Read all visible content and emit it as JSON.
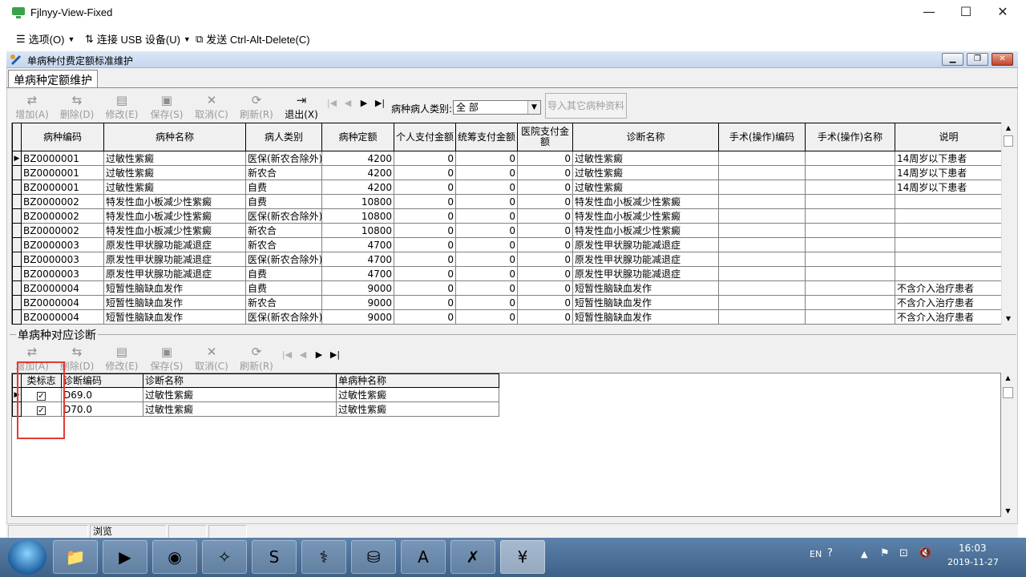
{
  "vm": {
    "title": "Fjlnyy-View-Fixed",
    "menu": {
      "options": "选项(O)",
      "usb": "连接 USB 设备(U)",
      "cad": "发送 Ctrl-Alt-Delete(C)"
    },
    "controls": {
      "min": "—",
      "max": "☐",
      "close": "✕"
    }
  },
  "app": {
    "title": "单病种付费定额标准维护",
    "tab": "单病种定额维护",
    "toolbar1": {
      "add": "增加(A)",
      "delete": "删除(D)",
      "edit": "修改(E)",
      "save": "保存(S)",
      "cancel": "取消(C)",
      "refresh": "刷新(R)",
      "exit": "退出(X)"
    },
    "filter_label": "病种病人类别:",
    "filter_value": "全 部",
    "import_button": "导入其它病种资料",
    "grid1": {
      "headers": [
        "病种编码",
        "病种名称",
        "病人类别",
        "病种定额",
        "个人支付金额",
        "统筹支付金额",
        "医院支付金额",
        "诊断名称",
        "手术(操作)编码",
        "手术(操作)名称",
        "说明"
      ],
      "rows": [
        [
          "BZ0000001",
          "过敏性紫癜",
          "医保(新农合除外)",
          "4200",
          "0",
          "0",
          "0",
          "过敏性紫癜",
          "",
          "",
          "14周岁以下患者"
        ],
        [
          "BZ0000001",
          "过敏性紫癜",
          "新农合",
          "4200",
          "0",
          "0",
          "0",
          "过敏性紫癜",
          "",
          "",
          "14周岁以下患者"
        ],
        [
          "BZ0000001",
          "过敏性紫癜",
          "自费",
          "4200",
          "0",
          "0",
          "0",
          "过敏性紫癜",
          "",
          "",
          "14周岁以下患者"
        ],
        [
          "BZ0000002",
          "特发性血小板减少性紫癜",
          "自费",
          "10800",
          "0",
          "0",
          "0",
          "特发性血小板减少性紫癜",
          "",
          "",
          ""
        ],
        [
          "BZ0000002",
          "特发性血小板减少性紫癜",
          "医保(新农合除外)",
          "10800",
          "0",
          "0",
          "0",
          "特发性血小板减少性紫癜",
          "",
          "",
          ""
        ],
        [
          "BZ0000002",
          "特发性血小板减少性紫癜",
          "新农合",
          "10800",
          "0",
          "0",
          "0",
          "特发性血小板减少性紫癜",
          "",
          "",
          ""
        ],
        [
          "BZ0000003",
          "原发性甲状腺功能减退症",
          "新农合",
          "4700",
          "0",
          "0",
          "0",
          "原发性甲状腺功能减退症",
          "",
          "",
          ""
        ],
        [
          "BZ0000003",
          "原发性甲状腺功能减退症",
          "医保(新农合除外)",
          "4700",
          "0",
          "0",
          "0",
          "原发性甲状腺功能减退症",
          "",
          "",
          ""
        ],
        [
          "BZ0000003",
          "原发性甲状腺功能减退症",
          "自费",
          "4700",
          "0",
          "0",
          "0",
          "原发性甲状腺功能减退症",
          "",
          "",
          ""
        ],
        [
          "BZ0000004",
          "短暂性脑缺血发作",
          "自费",
          "9000",
          "0",
          "0",
          "0",
          "短暂性脑缺血发作",
          "",
          "",
          "不含介入治疗患者"
        ],
        [
          "BZ0000004",
          "短暂性脑缺血发作",
          "新农合",
          "9000",
          "0",
          "0",
          "0",
          "短暂性脑缺血发作",
          "",
          "",
          "不含介入治疗患者"
        ],
        [
          "BZ0000004",
          "短暂性脑缺血发作",
          "医保(新农合除外)",
          "9000",
          "0",
          "0",
          "0",
          "短暂性脑缺血发作",
          "",
          "",
          "不含介入治疗患者"
        ]
      ]
    },
    "section2": "单病种对应诊断",
    "toolbar2": {
      "add": "增加(A)",
      "delete": "删除(D)",
      "edit": "修改(E)",
      "save": "保存(S)",
      "cancel": "取消(C)",
      "refresh": "刷新(R)"
    },
    "grid2": {
      "headers": [
        "类标志",
        "诊断编码",
        "诊断名称",
        "单病种名称"
      ],
      "rows": [
        [
          "✓",
          "D69.0",
          "过敏性紫癜",
          "过敏性紫癜"
        ],
        [
          "✓",
          "D70.0",
          "过敏性紫癜",
          "过敏性紫癜"
        ]
      ]
    },
    "status": "浏览"
  },
  "taskbar": {
    "lang": "EN",
    "time": "16:03",
    "date": "2019-11-27"
  },
  "colors": {
    "highlight_box": "#e53935",
    "title_bar": "#c4d6ee",
    "taskbar": "#4d729b"
  }
}
